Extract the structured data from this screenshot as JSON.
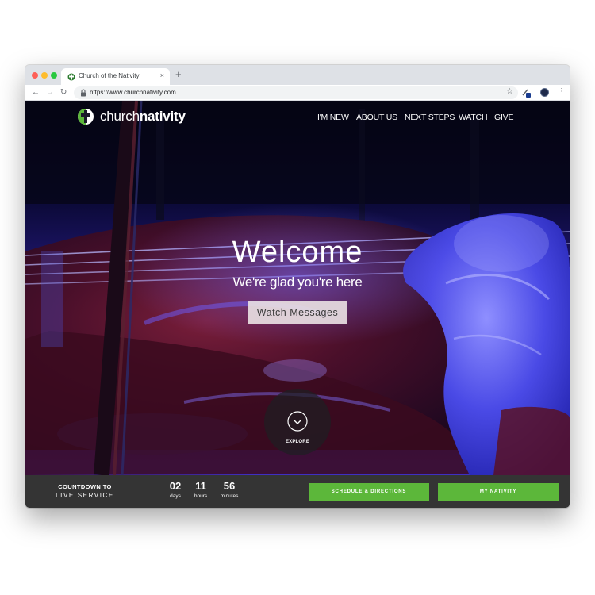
{
  "browser": {
    "tab_title": "Church of the Nativity",
    "tab_close": "×",
    "new_tab": "+",
    "url": "https://www.churchnativity.com",
    "back": "←",
    "forward": "→",
    "reload": "↻",
    "star": "☆",
    "menu": "⋮"
  },
  "site": {
    "logo_light": "church",
    "logo_bold": "nativity",
    "nav": [
      "I'M NEW",
      "ABOUT US",
      "NEXT STEPS",
      "WATCH",
      "GIVE"
    ]
  },
  "hero": {
    "title": "Welcome",
    "subtitle": "We're glad you're here",
    "cta": "Watch Messages",
    "explore": "EXPLORE"
  },
  "countdown": {
    "title": "COUNTDOWN TO",
    "subtitle": "LIVE SERVICE",
    "units": [
      {
        "value": "02",
        "label": "days"
      },
      {
        "value": "11",
        "label": "hours"
      },
      {
        "value": "56",
        "label": "minutes"
      }
    ],
    "buttons": [
      "SCHEDULE & DIRECTIONS",
      "MY NATIVITY"
    ]
  },
  "colors": {
    "accent_green": "#5cb73a",
    "countdown_bar": "#343434",
    "hero_blue": "#2a2ad0",
    "hero_red": "#5a0f1c"
  },
  "icons": [
    "favicon-icon",
    "lock-icon",
    "star-icon",
    "extension-icon",
    "profile-icon",
    "menu-icon",
    "logo-icon",
    "chevron-down-icon"
  ]
}
